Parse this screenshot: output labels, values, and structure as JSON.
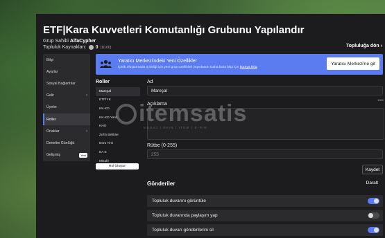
{
  "header": {
    "title": "ETF|Kara Kuvvetleri Komutanlığı Grubunu Yapılandır",
    "owner_label": "Grup Sahibi",
    "owner_name": "AlfaCypher",
    "credits_label": "Topluluk Kaynakları:",
    "credits_value": "0",
    "credits_sub": "(10.00)",
    "back_link": "Topluluğa dön"
  },
  "sidebar": {
    "items": [
      {
        "label": "Bilgi"
      },
      {
        "label": "Ayarlar"
      },
      {
        "label": "Sosyal Bağlantılar"
      },
      {
        "label": "Gelir"
      },
      {
        "label": "Üyeler"
      },
      {
        "label": "Roller"
      },
      {
        "label": "Ortaklar"
      },
      {
        "label": "Denetim Günlüğü"
      },
      {
        "label": "Gelişmiş",
        "badge": "Yeni"
      }
    ]
  },
  "banner": {
    "title": "Yaratıcı Merkezi'ndeki Yeni Özellikler",
    "desc": "İçerik oluşturmada iş birliği için yeni grup özellikleri yayınlandı! Daha fazla bilgi için",
    "link": "buraya tıkla",
    "button": "Yaratıcı Merkezi'ne git"
  },
  "roles": {
    "heading": "Roller",
    "items": [
      "Mareşal",
      "ETFİYK",
      "KK-KD",
      "KK-KD Yard.",
      "KHO",
      "Zırhlı Birlikler",
      "Börü Timi",
      "BA E",
      "Misafir"
    ],
    "create_button": "Rol Oluştur"
  },
  "form": {
    "name_label": "Ad",
    "name_value": "Mareşal",
    "desc_label": "Açıklama",
    "desc_counter": "1000",
    "rank_label": "Rütbe (0-255)",
    "rank_value": "255",
    "save_button": "Kaydet"
  },
  "permissions": {
    "heading": "Gönderiler",
    "collapse": "Daralt",
    "items": [
      {
        "label": "Topluluk duvarını görüntüle",
        "on": true
      },
      {
        "label": "Topluluk duvarında paylaşım yap",
        "on": false
      },
      {
        "label": "Topluluk duvarı gönderilerini sil",
        "on": true
      }
    ]
  },
  "watermark": {
    "main": "itemsatis",
    "sub": "MESAJ | SKIN | ITEM | E-PIN"
  },
  "colors": {
    "accent": "#5b7cf0",
    "panel": "#1c1c1e"
  }
}
